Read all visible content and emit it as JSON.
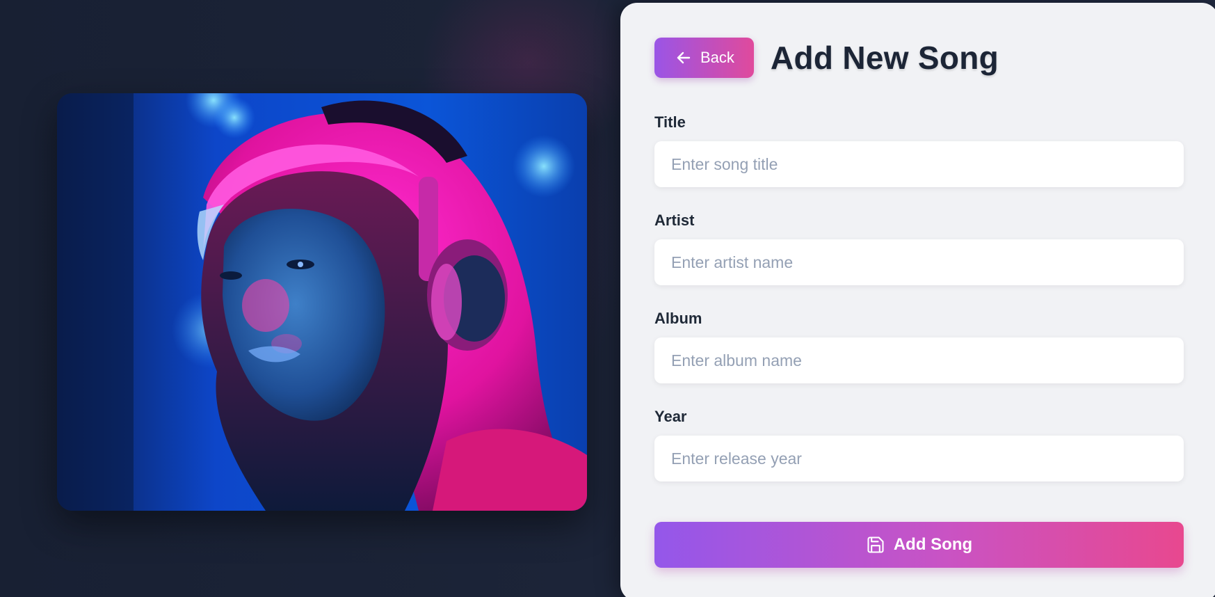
{
  "header": {
    "back_label": "Back",
    "title": "Add New Song"
  },
  "form": {
    "fields": [
      {
        "label": "Title",
        "placeholder": "Enter song title",
        "value": ""
      },
      {
        "label": "Artist",
        "placeholder": "Enter artist name",
        "value": ""
      },
      {
        "label": "Album",
        "placeholder": "Enter album name",
        "value": ""
      },
      {
        "label": "Year",
        "placeholder": "Enter release year",
        "value": ""
      }
    ],
    "submit_label": "Add Song"
  },
  "image": {
    "icon": "photo-of-woman-with-headphones"
  },
  "colors": {
    "accent_start": "#9457ea",
    "accent_end": "#e8488f",
    "panel_bg": "#f1f2f5",
    "page_bg": "#1b2234",
    "title_color": "#1c2536"
  }
}
